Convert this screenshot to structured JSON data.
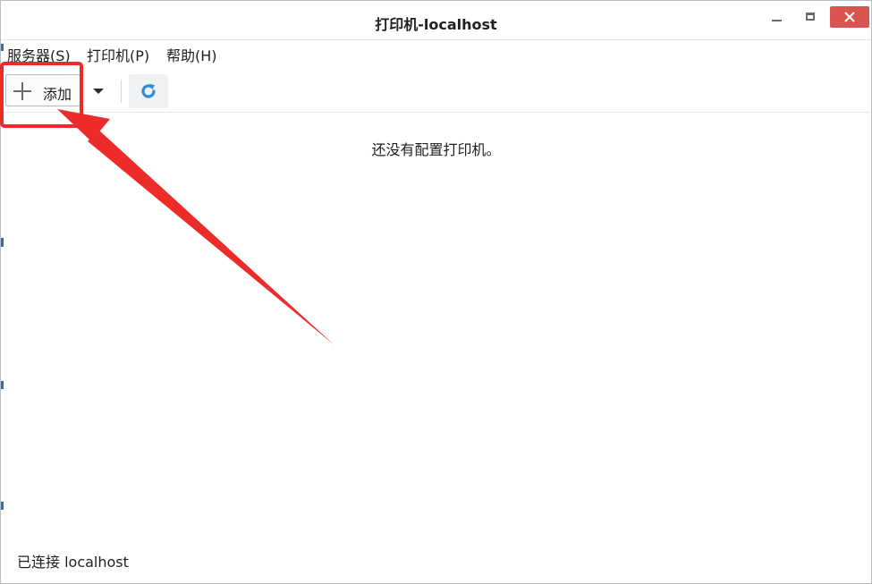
{
  "window": {
    "title": "打印机-localhost",
    "controls": [
      "minimize-icon",
      "maximize-icon",
      "close-icon"
    ]
  },
  "menubar": {
    "items": [
      {
        "label": "服务器(S)"
      },
      {
        "label": "打印机(P)"
      },
      {
        "label": "帮助(H)"
      }
    ]
  },
  "toolbar": {
    "add_label": "添加",
    "add_icon": "plus-icon",
    "dropdown_icon": "chevron-down-icon",
    "refresh_icon": "refresh-icon"
  },
  "content": {
    "empty_message": "还没有配置打印机。"
  },
  "status": {
    "text": "已连接 localhost"
  },
  "colors": {
    "annotation": "#ee2b2b",
    "close_button": "#d9534f",
    "refresh_icon": "#2a8fd8"
  }
}
